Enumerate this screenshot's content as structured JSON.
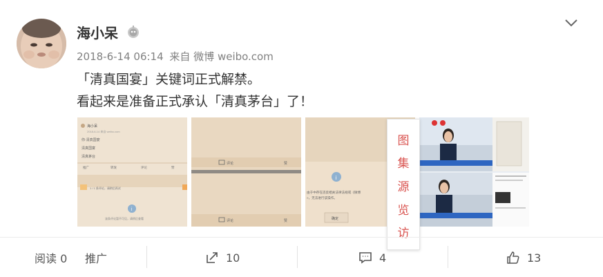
{
  "post": {
    "username": "海小呆",
    "time": "2018-6-14 06:14",
    "source": "来自 微博 weibo.com",
    "lines": [
      "「清真国宴」关键词正式解禁。",
      "看起来是准备正式承认「清真茅台」了！"
    ]
  },
  "gallery": {
    "chars": [
      "图",
      "集",
      "源",
      "览",
      "访"
    ]
  },
  "thumbs": {
    "t1": {
      "name": "海小呆",
      "meta": "2018-6-14 来自 weibo.com",
      "items": [
        "你·清真国宴",
        "清真国宴",
        "清真茅台"
      ],
      "actions": [
        "推广",
        "转发",
        "评论",
        "赞"
      ],
      "notice": "1 / 1 条评论，请稍后再试",
      "footer": "该条评论暂不可见，请稍后查看"
    },
    "t2": {
      "comment": "评论",
      "like": "赞"
    },
    "t3": {
      "notice_line1": "由于中存在违反相关法律法规或《微博",
      "notice_line2": "»，无法进行该操作。",
      "confirm": "确定"
    }
  },
  "actions": {
    "read_label": "阅读 0",
    "promote_label": "推广",
    "repost_count": "10",
    "comment_count": "4",
    "like_count": "13"
  },
  "colors": {
    "accent": "#d9534f",
    "divider": "#ececec"
  }
}
